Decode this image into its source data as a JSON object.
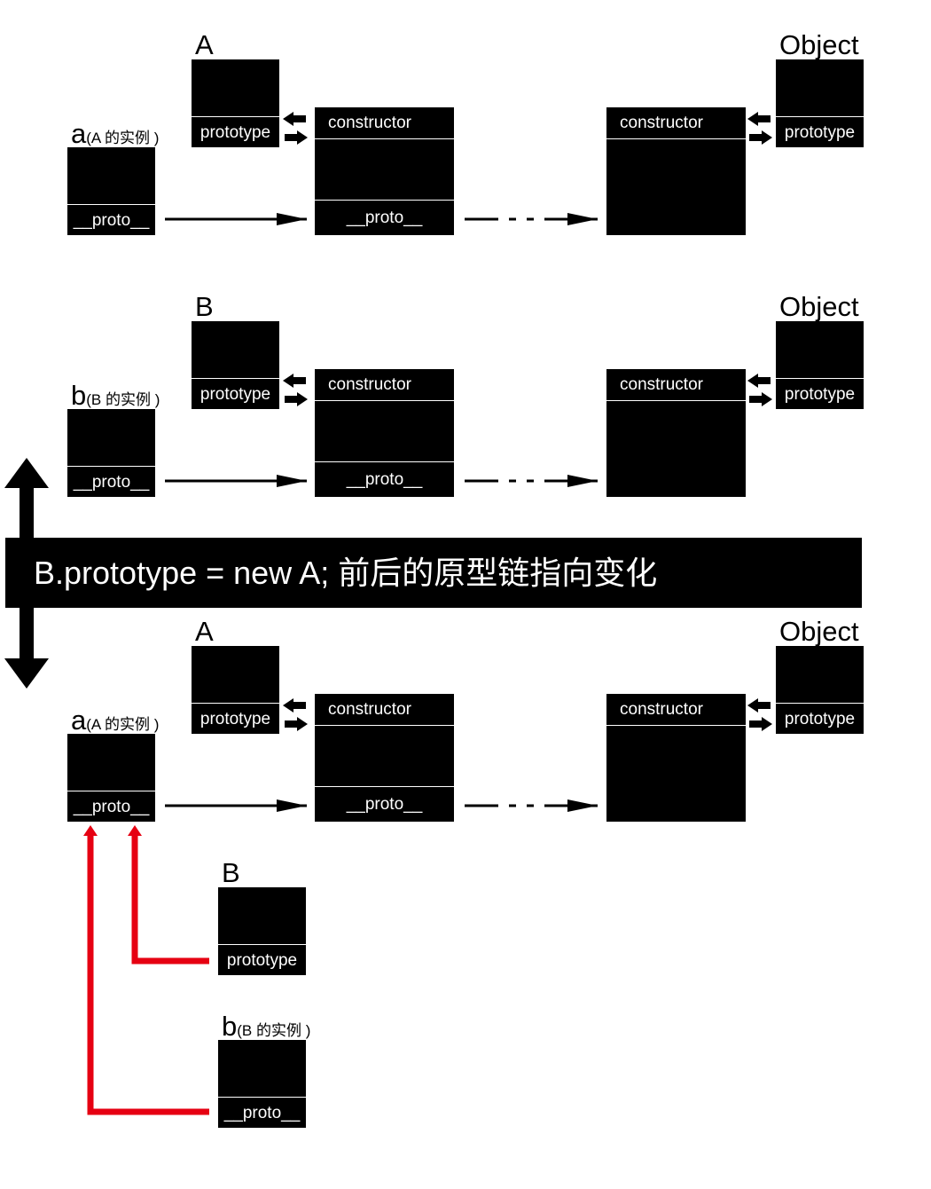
{
  "banner": {
    "text": "B.prototype = new A; 前后的原型链指向变化"
  },
  "sections": [
    {
      "ctor_label": "A",
      "instance_letter": "a",
      "instance_note": "(A 的实例 )",
      "object_label": "Object",
      "prototype_label": "prototype",
      "proto_label": "__proto__",
      "constructor_label": "constructor",
      "obj_constructor_label": "constructor",
      "obj_prototype_label": "prototype"
    },
    {
      "ctor_label": "B",
      "instance_letter": "b",
      "instance_note": "(B 的实例 )",
      "object_label": "Object",
      "prototype_label": "prototype",
      "proto_label": "__proto__",
      "constructor_label": "constructor",
      "obj_constructor_label": "constructor",
      "obj_prototype_label": "prototype"
    },
    {
      "ctor_label": "A",
      "instance_letter": "a",
      "instance_note": "(A 的实例 )",
      "object_label": "Object",
      "prototype_label": "prototype",
      "proto_label": "__proto__",
      "constructor_label": "constructor",
      "obj_constructor_label": "constructor",
      "obj_prototype_label": "prototype"
    }
  ],
  "after": {
    "b_ctor_label": "B",
    "b_prototype_label": "prototype",
    "b_instance_letter": "b",
    "b_instance_note": "(B 的实例 )",
    "b_proto_label": "__proto__"
  },
  "colors": {
    "box": "#000000",
    "box_text": "#ffffff",
    "link_red": "#e60012"
  }
}
